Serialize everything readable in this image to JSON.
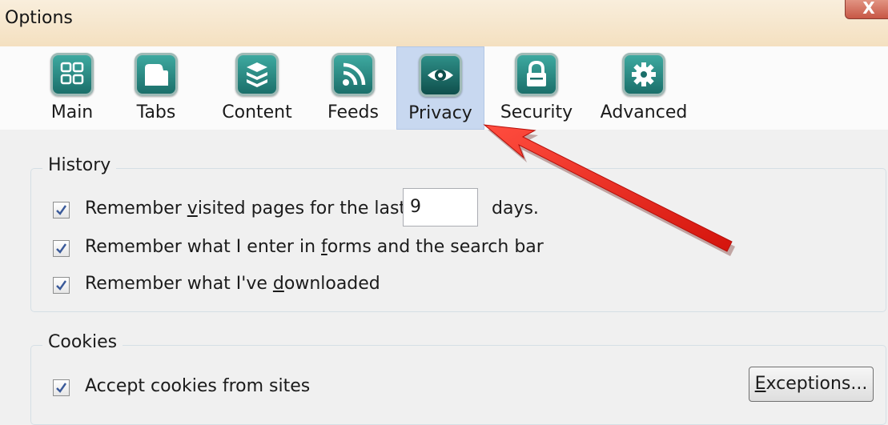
{
  "window": {
    "title": "Options",
    "close_label": "X"
  },
  "toolbar": {
    "selected": "Privacy",
    "tabs": [
      {
        "label": "Main",
        "icon": "main-icon"
      },
      {
        "label": "Tabs",
        "icon": "tabs-icon"
      },
      {
        "label": "Content",
        "icon": "content-icon"
      },
      {
        "label": "Feeds",
        "icon": "rss-icon"
      },
      {
        "label": "Privacy",
        "icon": "eye-icon"
      },
      {
        "label": "Security",
        "icon": "lock-icon"
      },
      {
        "label": "Advanced",
        "icon": "gear-icon"
      }
    ]
  },
  "history": {
    "legend": "History",
    "items": [
      {
        "label_pre": "Remember ",
        "accel": "v",
        "label_post": "isited pages for the last",
        "checked": true
      },
      {
        "label_pre": "Remember what I enter in ",
        "accel": "f",
        "label_post": "orms and the search bar",
        "checked": true
      },
      {
        "label_pre": "Remember what I've ",
        "accel": "d",
        "label_post": "ownloaded",
        "checked": true
      }
    ],
    "days_value": "9",
    "days_suffix": "days."
  },
  "cookies": {
    "legend": "Cookies",
    "accept_label": "Accept cookies from sites",
    "accept_checked": true,
    "exceptions_accel": "E",
    "exceptions_rest": "xceptions..."
  },
  "colors": {
    "selected_tab_bg": "#c8d8f0",
    "icon_teal": "#2a8e86",
    "arrow_red": "#e8251b"
  }
}
